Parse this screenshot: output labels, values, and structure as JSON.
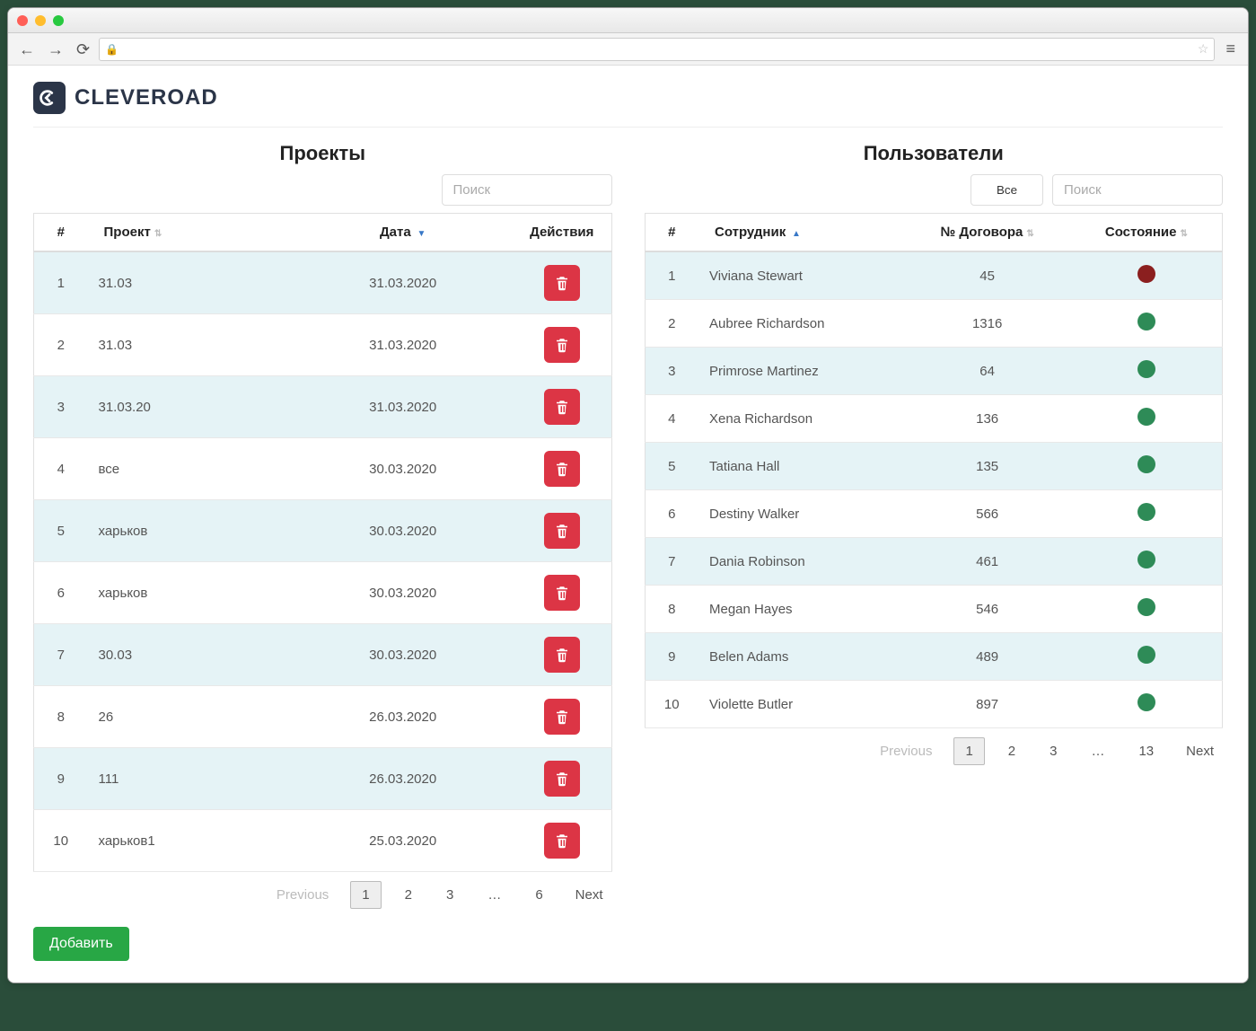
{
  "brand": "CLEVEROAD",
  "projects": {
    "title": "Проекты",
    "searchPlaceholder": "Поиск",
    "columns": {
      "num": "#",
      "project": "Проект",
      "date": "Дата",
      "actions": "Действия"
    },
    "rows": [
      {
        "n": "1",
        "name": "31.03",
        "date": "31.03.2020"
      },
      {
        "n": "2",
        "name": "31.03",
        "date": "31.03.2020"
      },
      {
        "n": "3",
        "name": "31.03.20",
        "date": "31.03.2020"
      },
      {
        "n": "4",
        "name": "все",
        "date": "30.03.2020"
      },
      {
        "n": "5",
        "name": "харьков",
        "date": "30.03.2020"
      },
      {
        "n": "6",
        "name": "харьков",
        "date": "30.03.2020"
      },
      {
        "n": "7",
        "name": "30.03",
        "date": "30.03.2020"
      },
      {
        "n": "8",
        "name": "26",
        "date": "26.03.2020"
      },
      {
        "n": "9",
        "name": "111",
        "date": "26.03.2020"
      },
      {
        "n": "10",
        "name": "харьков1",
        "date": "25.03.2020"
      }
    ],
    "pagination": {
      "prev": "Previous",
      "next": "Next",
      "pages": [
        "1",
        "2",
        "3",
        "…",
        "6"
      ],
      "current": "1"
    }
  },
  "users": {
    "title": "Пользователи",
    "allLabel": "Все",
    "searchPlaceholder": "Поиск",
    "columns": {
      "num": "#",
      "employee": "Сотрудник",
      "contract": "№ Договора",
      "status": "Состояние"
    },
    "rows": [
      {
        "n": "1",
        "name": "Viviana Stewart",
        "contract": "45",
        "status": "red"
      },
      {
        "n": "2",
        "name": "Aubree Richardson",
        "contract": "1316",
        "status": "green"
      },
      {
        "n": "3",
        "name": "Primrose Martinez",
        "contract": "64",
        "status": "green"
      },
      {
        "n": "4",
        "name": "Xena Richardson",
        "contract": "136",
        "status": "green"
      },
      {
        "n": "5",
        "name": "Tatiana Hall",
        "contract": "135",
        "status": "green"
      },
      {
        "n": "6",
        "name": "Destiny Walker",
        "contract": "566",
        "status": "green"
      },
      {
        "n": "7",
        "name": "Dania Robinson",
        "contract": "461",
        "status": "green"
      },
      {
        "n": "8",
        "name": "Megan Hayes",
        "contract": "546",
        "status": "green"
      },
      {
        "n": "9",
        "name": "Belen Adams",
        "contract": "489",
        "status": "green"
      },
      {
        "n": "10",
        "name": "Violette Butler",
        "contract": "897",
        "status": "green"
      }
    ],
    "pagination": {
      "prev": "Previous",
      "next": "Next",
      "pages": [
        "1",
        "2",
        "3",
        "…",
        "13"
      ],
      "current": "1"
    }
  },
  "addButton": "Добавить"
}
